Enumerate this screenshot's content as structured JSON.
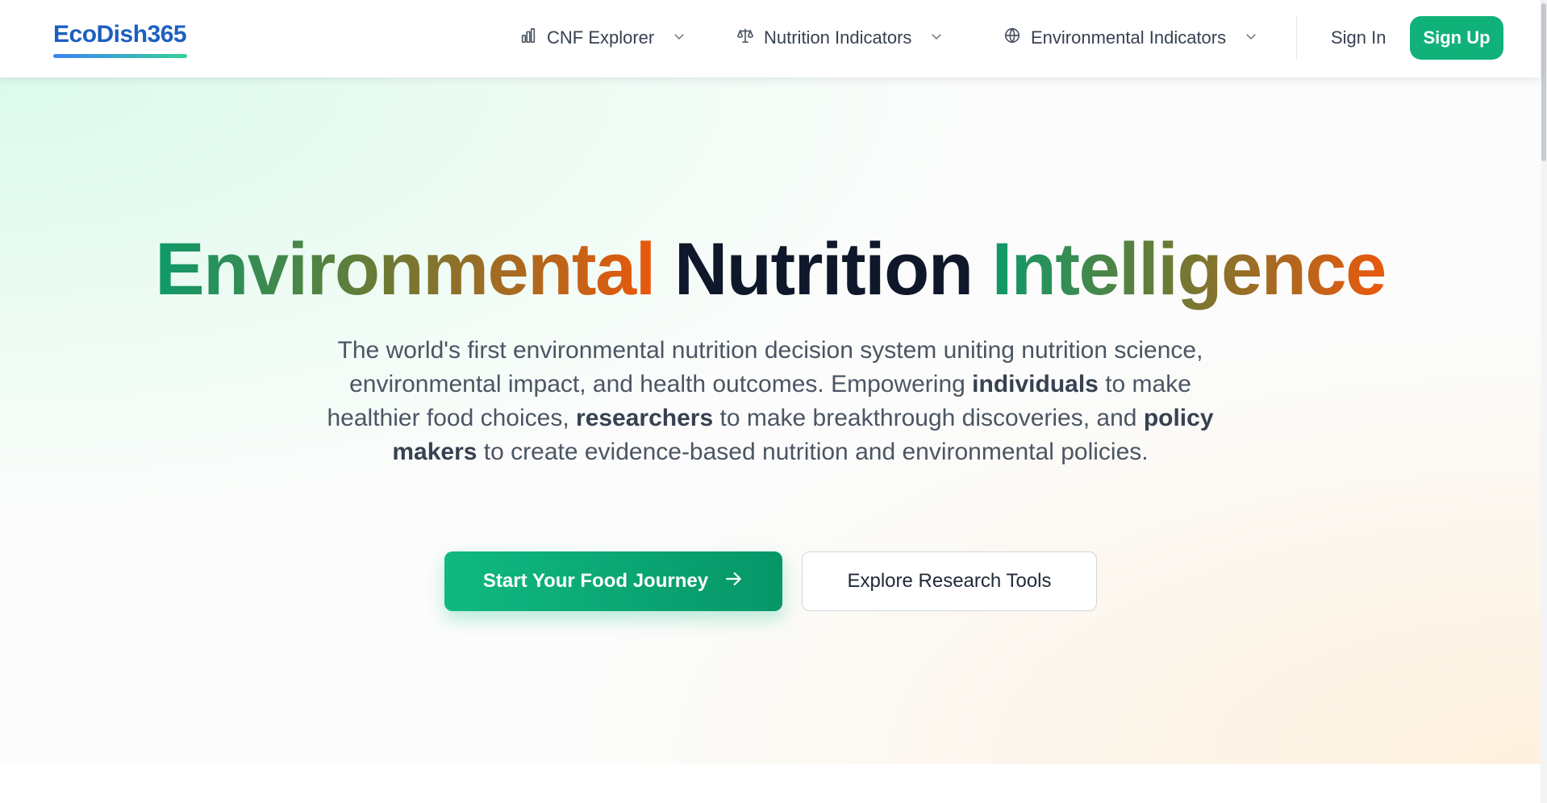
{
  "header": {
    "logo": "EcoDish365",
    "nav": [
      {
        "label": "CNF Explorer",
        "icon": "bar-chart-icon"
      },
      {
        "label": "Nutrition Indicators",
        "icon": "scale-icon"
      },
      {
        "label": "Environmental Indicators",
        "icon": "globe-icon"
      }
    ],
    "sign_in": "Sign In",
    "sign_up": "Sign Up"
  },
  "hero": {
    "title_part1": "Environmental",
    "title_part2": "Nutrition",
    "title_part3": "Intelligence",
    "description": {
      "intro": "The world's first environmental nutrition decision system uniting nutrition science, environmental impact, and health outcomes. Empowering ",
      "bold1": "individuals",
      "mid1": " to make healthier food choices, ",
      "bold2": "researchers",
      "mid2": " to make breakthrough discoveries, and ",
      "bold3": "policy makers",
      "end": " to create evidence-based nutrition and environmental policies."
    },
    "primary_button": "Start Your Food Journey",
    "secondary_button": "Explore Research Tools"
  },
  "colors": {
    "brand_green": "#10b27a",
    "logo_blue": "#1d5fbf",
    "gradient_start": "#0e9a6a",
    "gradient_end": "#ea580c",
    "title_dark": "#0f172a"
  }
}
